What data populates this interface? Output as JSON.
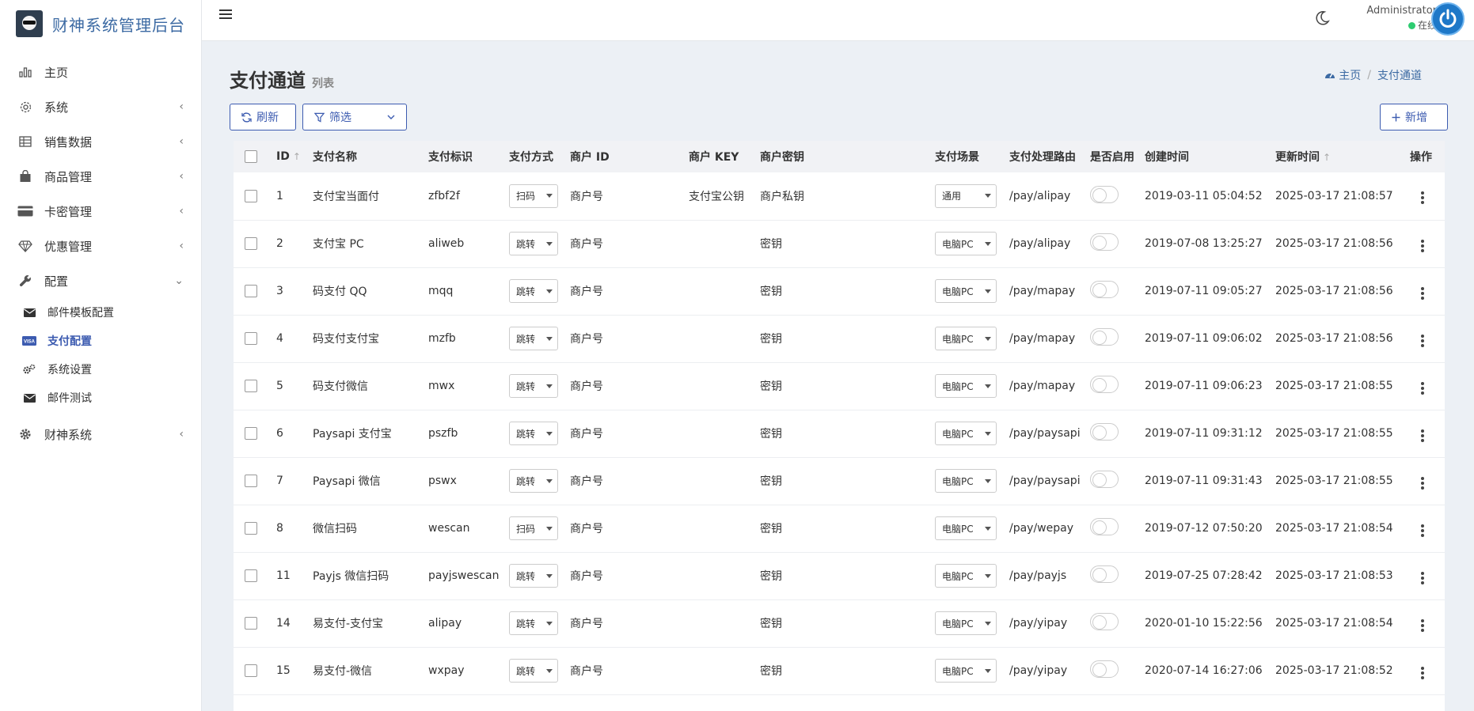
{
  "app": {
    "title": "财神系统管理后台"
  },
  "sidebar": {
    "items": [
      {
        "label": "主页",
        "icon": "bar-chart-icon",
        "chevron": ""
      },
      {
        "label": "系统",
        "icon": "gear-icon",
        "chevron": "‹"
      },
      {
        "label": "销售数据",
        "icon": "table-icon",
        "chevron": "‹"
      },
      {
        "label": "商品管理",
        "icon": "shopping-bag-icon",
        "chevron": "‹"
      },
      {
        "label": "卡密管理",
        "icon": "credit-card-icon",
        "chevron": "‹"
      },
      {
        "label": "优惠管理",
        "icon": "diamond-icon",
        "chevron": "‹"
      },
      {
        "label": "配置",
        "icon": "wrench-icon",
        "chevron": "⌄"
      },
      {
        "label": "财神系统",
        "icon": "gear-solid-icon",
        "chevron": "‹"
      }
    ],
    "submenu": [
      {
        "label": "邮件模板配置",
        "icon": "envelope-icon"
      },
      {
        "label": "支付配置",
        "icon": "visa-icon",
        "active": true
      },
      {
        "label": "系统设置",
        "icon": "gears-icon"
      },
      {
        "label": "邮件测试",
        "icon": "envelope-icon"
      }
    ]
  },
  "header": {
    "user_name": "Administrator",
    "user_status": "在线",
    "status_color": "#2ecc71"
  },
  "page": {
    "title": "支付通道",
    "subtitle": "列表",
    "breadcrumb_home": "主页",
    "breadcrumb_current": "支付通道"
  },
  "toolbar": {
    "refresh_label": "刷新",
    "filter_label": "筛选",
    "add_label": "新增"
  },
  "table": {
    "columns": [
      "ID",
      "支付名称",
      "支付标识",
      "支付方式",
      "商户 ID",
      "商户 KEY",
      "商户密钥",
      "支付场景",
      "支付处理路由",
      "是否启用",
      "创建时间",
      "更新时间",
      "操作"
    ],
    "rows": [
      {
        "id": "1",
        "name": "支付宝当面付",
        "code": "zfbf2f",
        "method": "扫码",
        "merchant_id": "商户号",
        "merchant_key": "支付宝公钥",
        "secret": "商户私钥",
        "scene": "通用",
        "route": "/pay/alipay",
        "enabled": false,
        "created": "2019-03-11 05:04:52",
        "updated": "2025-03-17 21:08:57"
      },
      {
        "id": "2",
        "name": "支付宝 PC",
        "code": "aliweb",
        "method": "跳转",
        "merchant_id": "商户号",
        "merchant_key": "",
        "secret": "密钥",
        "scene": "电脑PC",
        "route": "/pay/alipay",
        "enabled": false,
        "created": "2019-07-08 13:25:27",
        "updated": "2025-03-17 21:08:56"
      },
      {
        "id": "3",
        "name": "码支付 QQ",
        "code": "mqq",
        "method": "跳转",
        "merchant_id": "商户号",
        "merchant_key": "",
        "secret": "密钥",
        "scene": "电脑PC",
        "route": "/pay/mapay",
        "enabled": false,
        "created": "2019-07-11 09:05:27",
        "updated": "2025-03-17 21:08:56"
      },
      {
        "id": "4",
        "name": "码支付支付宝",
        "code": "mzfb",
        "method": "跳转",
        "merchant_id": "商户号",
        "merchant_key": "",
        "secret": "密钥",
        "scene": "电脑PC",
        "route": "/pay/mapay",
        "enabled": false,
        "created": "2019-07-11 09:06:02",
        "updated": "2025-03-17 21:08:56"
      },
      {
        "id": "5",
        "name": "码支付微信",
        "code": "mwx",
        "method": "跳转",
        "merchant_id": "商户号",
        "merchant_key": "",
        "secret": "密钥",
        "scene": "电脑PC",
        "route": "/pay/mapay",
        "enabled": false,
        "created": "2019-07-11 09:06:23",
        "updated": "2025-03-17 21:08:55"
      },
      {
        "id": "6",
        "name": "Paysapi 支付宝",
        "code": "pszfb",
        "method": "跳转",
        "merchant_id": "商户号",
        "merchant_key": "",
        "secret": "密钥",
        "scene": "电脑PC",
        "route": "/pay/paysapi",
        "enabled": false,
        "created": "2019-07-11 09:31:12",
        "updated": "2025-03-17 21:08:55"
      },
      {
        "id": "7",
        "name": "Paysapi 微信",
        "code": "pswx",
        "method": "跳转",
        "merchant_id": "商户号",
        "merchant_key": "",
        "secret": "密钥",
        "scene": "电脑PC",
        "route": "/pay/paysapi",
        "enabled": false,
        "created": "2019-07-11 09:31:43",
        "updated": "2025-03-17 21:08:55"
      },
      {
        "id": "8",
        "name": "微信扫码",
        "code": "wescan",
        "method": "扫码",
        "merchant_id": "商户号",
        "merchant_key": "",
        "secret": "密钥",
        "scene": "电脑PC",
        "route": "/pay/wepay",
        "enabled": false,
        "created": "2019-07-12 07:50:20",
        "updated": "2025-03-17 21:08:54"
      },
      {
        "id": "11",
        "name": "Payjs 微信扫码",
        "code": "payjswescan",
        "method": "跳转",
        "merchant_id": "商户号",
        "merchant_key": "",
        "secret": "密钥",
        "scene": "电脑PC",
        "route": "/pay/payjs",
        "enabled": false,
        "created": "2019-07-25 07:28:42",
        "updated": "2025-03-17 21:08:53"
      },
      {
        "id": "14",
        "name": "易支付-支付宝",
        "code": "alipay",
        "method": "跳转",
        "merchant_id": "商户号",
        "merchant_key": "",
        "secret": "密钥",
        "scene": "电脑PC",
        "route": "/pay/yipay",
        "enabled": false,
        "created": "2020-01-10 15:22:56",
        "updated": "2025-03-17 21:08:54"
      },
      {
        "id": "15",
        "name": "易支付-微信",
        "code": "wxpay",
        "method": "跳转",
        "merchant_id": "商户号",
        "merchant_key": "",
        "secret": "密钥",
        "scene": "电脑PC",
        "route": "/pay/yipay",
        "enabled": false,
        "created": "2020-07-14 16:27:06",
        "updated": "2025-03-17 21:08:52"
      }
    ]
  },
  "colors": {
    "accent": "#3c5bb0",
    "brand_text": "#3c6aa3",
    "avatar": "#1e78c8",
    "content_bg": "#ecf0f5",
    "table_head_bg": "#f1f2f5"
  }
}
